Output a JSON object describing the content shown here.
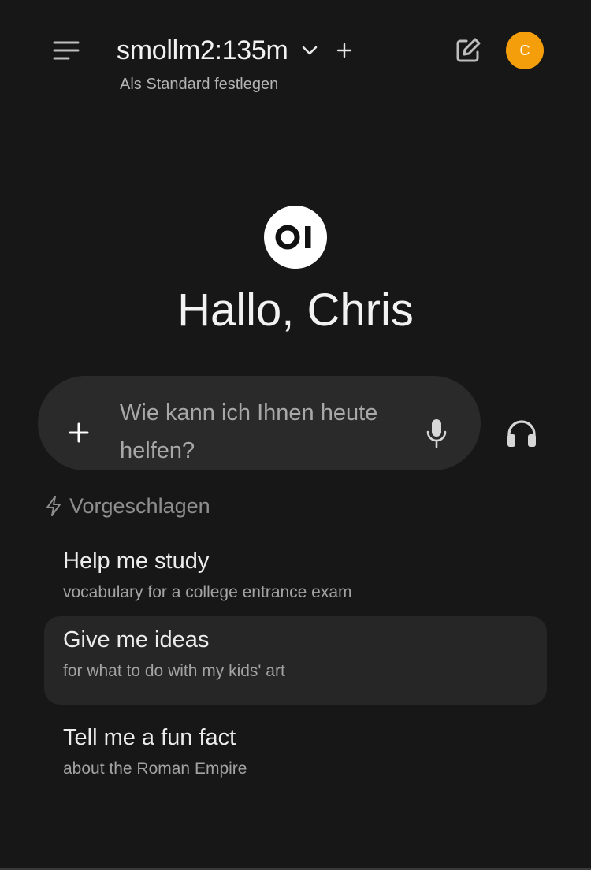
{
  "header": {
    "model_name": "smollm2:135m",
    "set_default": "Als Standard festlegen",
    "avatar_initial": "C",
    "avatar_color": "#f59e0b"
  },
  "hero": {
    "logo_text": "OI",
    "greeting": "Hallo, Chris"
  },
  "chat_input": {
    "placeholder": "Wie kann ich Ihnen heute helfen?"
  },
  "suggestions": {
    "heading": "Vorgeschlagen",
    "items": [
      {
        "title": "Help me study",
        "subtitle": "vocabulary for a college entrance exam"
      },
      {
        "title": "Give me ideas",
        "subtitle": "for what to do with my kids' art"
      },
      {
        "title": "Tell me a fun fact",
        "subtitle": "about the Roman Empire"
      }
    ]
  },
  "icons": {
    "menu": "menu-icon",
    "model_dropdown": "chevron-down-icon",
    "add_model": "plus-icon",
    "new_chat": "edit-icon",
    "attach": "plus-icon",
    "mic": "microphone-icon",
    "voice": "headphones-icon",
    "suggestions": "lightning-icon"
  }
}
